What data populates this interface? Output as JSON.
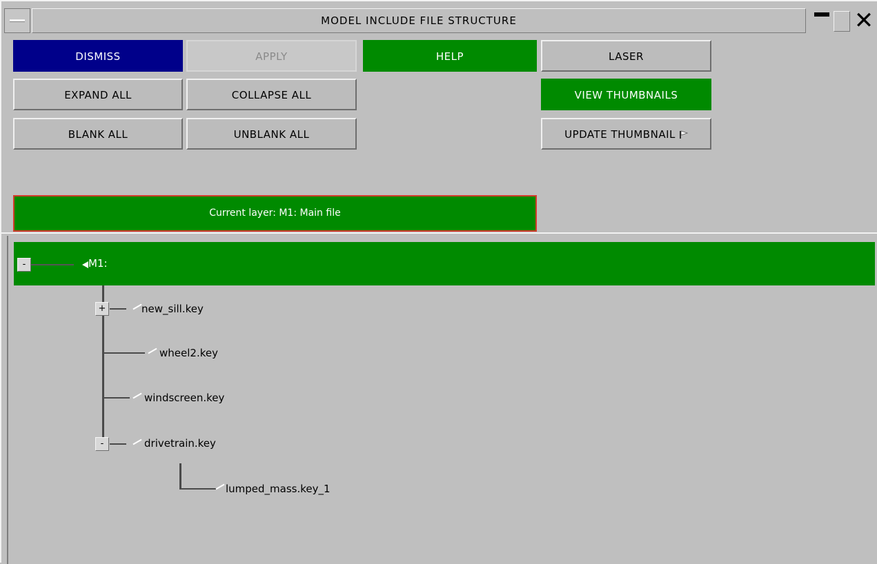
{
  "window": {
    "title": "MODEL INCLUDE FILE STRUCTURE"
  },
  "toolbar": {
    "dismiss": "DISMISS",
    "apply": "APPLY",
    "help": "HELP",
    "laser": "LASER",
    "expand_all": "EXPAND ALL",
    "collapse_all": "COLLAPSE ALL",
    "view_thumbnails": "VIEW THUMBNAILS",
    "blank_all": "BLANK ALL",
    "unblank_all": "UNBLANK ALL",
    "update_thumbnail": "UPDATE THUMBNAIL"
  },
  "current_layer": "Current layer: M1: Main file",
  "tree": {
    "root": {
      "label": "M1:",
      "expander": "-"
    },
    "children": [
      {
        "label": "new_sill.key",
        "expander": "+"
      },
      {
        "label": "wheel2.key"
      },
      {
        "label": "windscreen.key"
      },
      {
        "label": "drivetrain.key",
        "expander": "-"
      },
      {
        "label": "lumped_mass.key_1"
      }
    ]
  },
  "colors": {
    "background": "#bfbfbf",
    "navy": "#00008a",
    "green": "#008a00",
    "highlight_border": "#d23b2b"
  },
  "icons": [
    "window-menu-icon",
    "minimize-icon",
    "maximize-icon",
    "close-icon",
    "flag-icon",
    "arrow-left-icon",
    "tick-icon"
  ]
}
